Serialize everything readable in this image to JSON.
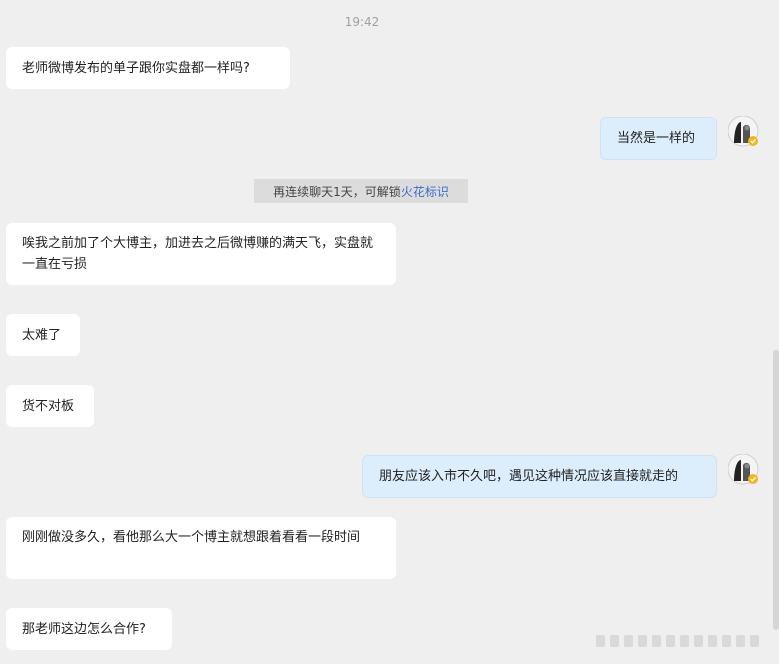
{
  "chat": {
    "timestamp": "19:42",
    "notice": {
      "text": "再连续聊天1天，可解锁",
      "link": "火花标识"
    },
    "messages": [
      {
        "side": "left",
        "text": "老师微博发布的单子跟你实盘都一样吗?"
      },
      {
        "side": "right",
        "text": "当然是一样的"
      },
      {
        "side": "left",
        "text": "唉我之前加了个大博主，加进去之后微博赚的满天飞，实盘就一直在亏损"
      },
      {
        "side": "left",
        "text": "太难了"
      },
      {
        "side": "left",
        "text": "货不对板"
      },
      {
        "side": "right",
        "text": "朋友应该入市不久吧，遇见这种情况应该直接就走的"
      },
      {
        "side": "left",
        "text": "刚刚做没多久，看他那么大一个博主就想跟着看看一段时间"
      },
      {
        "side": "left",
        "text": "那老师这边怎么合作?"
      }
    ]
  },
  "icons": {
    "avatar": "user-avatar-icon",
    "badge": "verified-badge-icon"
  },
  "colors": {
    "background": "#efefef",
    "left_bubble": "#ffffff",
    "right_bubble": "#dcedfb",
    "link": "#3b6dc8",
    "badge": "#f2b61e"
  }
}
